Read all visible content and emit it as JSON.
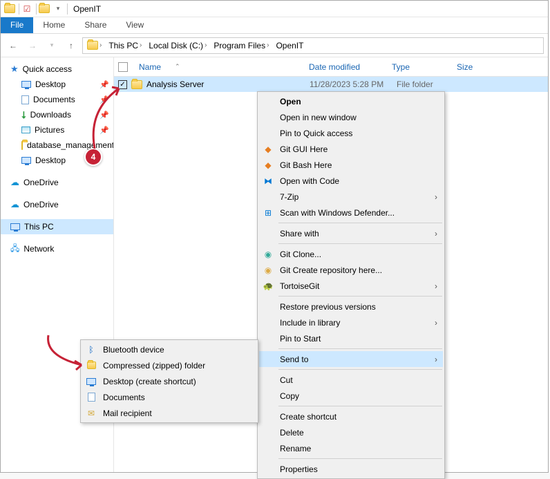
{
  "window": {
    "title": "OpenIT"
  },
  "ribbon": {
    "file": "File",
    "home": "Home",
    "share": "Share",
    "view": "View"
  },
  "breadcrumb": [
    "This PC",
    "Local Disk (C:)",
    "Program Files",
    "OpenIT"
  ],
  "sidebar": {
    "quick_access": "Quick access",
    "items": [
      "Desktop",
      "Documents",
      "Downloads",
      "Pictures",
      "database_management"
    ],
    "desktop2": "Desktop",
    "onedrive1": "OneDrive",
    "onedrive2": "OneDrive",
    "thispc": "This PC",
    "network": "Network"
  },
  "columns": {
    "name": "Name",
    "date": "Date modified",
    "type": "Type",
    "size": "Size"
  },
  "row": {
    "name": "Analysis Server",
    "date": "11/28/2023 5:28 PM",
    "type": "File folder"
  },
  "context": {
    "open": "Open",
    "open_new": "Open in new window",
    "pin_qa": "Pin to Quick access",
    "git_gui": "Git GUI Here",
    "git_bash": "Git Bash Here",
    "open_code": "Open with Code",
    "sevenzip": "7-Zip",
    "defender": "Scan with Windows Defender...",
    "share_with": "Share with",
    "git_clone": "Git Clone...",
    "git_create": "Git Create repository here...",
    "tortoise": "TortoiseGit",
    "restore": "Restore previous versions",
    "include_lib": "Include in library",
    "pin_start": "Pin to Start",
    "send_to": "Send to",
    "cut": "Cut",
    "copy": "Copy",
    "create_sc": "Create shortcut",
    "delete": "Delete",
    "rename": "Rename",
    "properties": "Properties"
  },
  "sendto": {
    "bluetooth": "Bluetooth device",
    "zip": "Compressed (zipped) folder",
    "desktop_sc": "Desktop (create shortcut)",
    "documents": "Documents",
    "mail": "Mail recipient"
  },
  "badge": "4"
}
